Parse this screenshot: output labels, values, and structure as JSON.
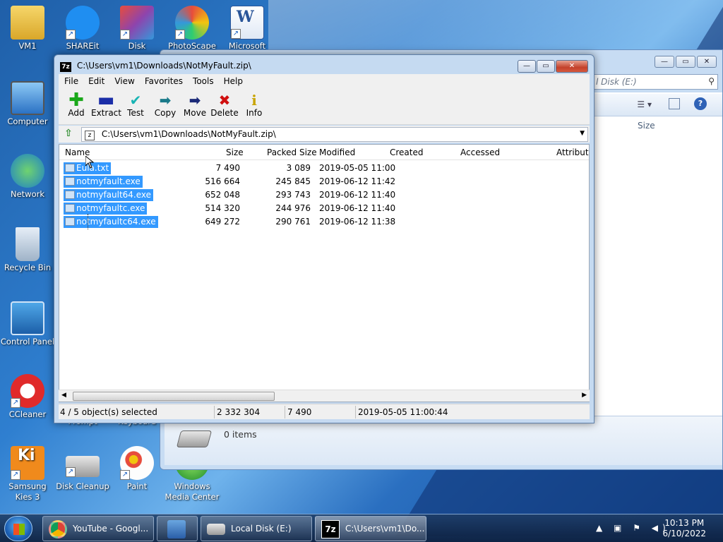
{
  "desktop": {
    "icons": [
      {
        "label": "VM1",
        "icon": "user-folder-icon"
      },
      {
        "label": "SHAREit",
        "icon": "shareit-icon"
      },
      {
        "label": "Disk",
        "icon": "disk-defrag-icon"
      },
      {
        "label": "PhotoScape",
        "icon": "photoscape-icon"
      },
      {
        "label": "Microsoft",
        "icon": "word-icon"
      },
      {
        "label": "Computer",
        "icon": "computer-icon"
      },
      {
        "label": "Network",
        "icon": "network-icon"
      },
      {
        "label": "Recycle Bin",
        "icon": "recycle-bin-icon"
      },
      {
        "label": "Control Panel",
        "icon": "control-panel-icon"
      },
      {
        "label": "CCleaner",
        "icon": "ccleaner-icon"
      },
      {
        "label": "Samsung Kies 3",
        "icon": "kies-icon"
      },
      {
        "label": "Disk Cleanup",
        "icon": "disk-cleanup-icon"
      },
      {
        "label": "Paint",
        "icon": "paint-icon"
      },
      {
        "label": "Windows Media Center",
        "icon": "media-center-icon"
      },
      {
        "label": "Prompt",
        "icon": "prompt-icon"
      },
      {
        "label": "Keyboard",
        "icon": "keyboard-icon"
      }
    ]
  },
  "explorer": {
    "search_placeholder": "l Disk (E:)",
    "column_size": "Size",
    "items_count": "0 items"
  },
  "zip": {
    "title": "C:\\Users\\vm1\\Downloads\\NotMyFault.zip\\",
    "menu": [
      "File",
      "Edit",
      "View",
      "Favorites",
      "Tools",
      "Help"
    ],
    "toolbar": [
      {
        "label": "Add",
        "icon": "add-icon",
        "color": "#1aa81a"
      },
      {
        "label": "Extract",
        "icon": "extract-icon",
        "color": "#1b2ea8"
      },
      {
        "label": "Test",
        "icon": "test-icon",
        "color": "#18b4b4"
      },
      {
        "label": "Copy",
        "icon": "copy-icon",
        "color": "#1a7a8a"
      },
      {
        "label": "Move",
        "icon": "move-icon",
        "color": "#1b2a78"
      },
      {
        "label": "Delete",
        "icon": "delete-icon",
        "color": "#d01010"
      },
      {
        "label": "Info",
        "icon": "info-icon",
        "color": "#c8a400"
      }
    ],
    "address": "C:\\Users\\vm1\\Downloads\\NotMyFault.zip\\",
    "columns": [
      "Name",
      "Size",
      "Packed Size",
      "Modified",
      "Created",
      "Accessed",
      "Attributes"
    ],
    "files": [
      {
        "name": "Eula.txt",
        "size": "7 490",
        "packed": "3 089",
        "modified": "2019-05-05 11:00"
      },
      {
        "name": "notmyfault.exe",
        "size": "516 664",
        "packed": "245 845",
        "modified": "2019-06-12 11:42"
      },
      {
        "name": "notmyfault64.exe",
        "size": "652 048",
        "packed": "293 743",
        "modified": "2019-06-12 11:40"
      },
      {
        "name": "notmyfaultc.exe",
        "size": "514 320",
        "packed": "244 976",
        "modified": "2019-06-12 11:40"
      },
      {
        "name": "notmyfaultc64.exe",
        "size": "649 272",
        "packed": "290 761",
        "modified": "2019-06-12 11:38"
      }
    ],
    "status": {
      "selected": "4 / 5 object(s) selected",
      "total_size": "2 332 304",
      "item_size": "7 490",
      "item_date": "2019-05-05 11:00:44"
    }
  },
  "taskbar": {
    "items": [
      {
        "label": "YouTube - Googl...",
        "icon": "chrome-icon"
      },
      {
        "label": "",
        "icon": "store-icon"
      },
      {
        "label": "Local Disk (E:)",
        "icon": "drive-icon"
      },
      {
        "label": "C:\\Users\\vm1\\Do...",
        "icon": "7zip-icon"
      }
    ],
    "time": "10:13 PM",
    "date": "6/10/2022"
  }
}
